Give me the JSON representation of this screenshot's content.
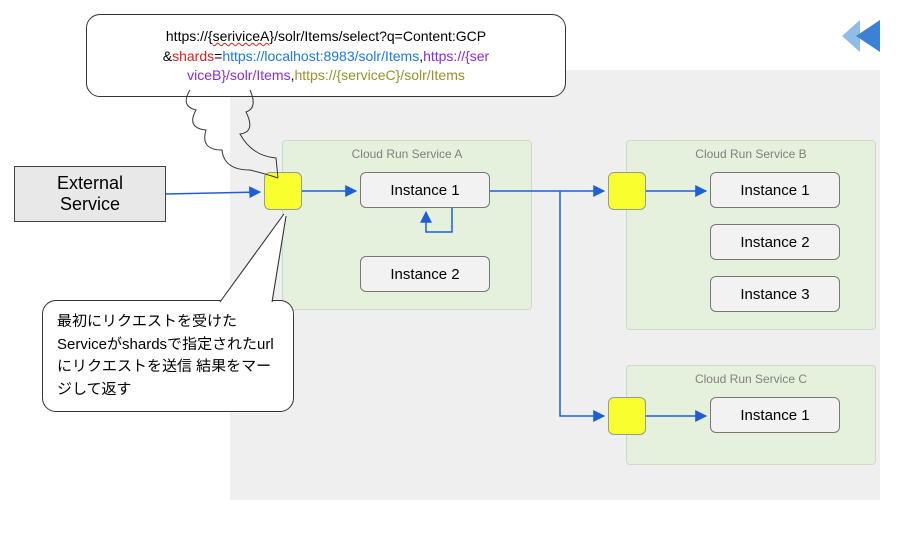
{
  "external": {
    "label": "External\nService"
  },
  "url": {
    "line1_a": "https://{",
    "line1_b": "seriviceA",
    "line1_c": "}/solr/Items/select?q=Content:GCP",
    "amp": "&",
    "shards": "shards",
    "eq": "=",
    "shard1": "https://localhost:8983/solr/Items",
    "comma1": ",",
    "shard2a": "https://{ser",
    "shard2b": "viceB}/solr/Items",
    "comma2": ",",
    "shard3": "https://{serviceC}/solr/Items"
  },
  "note": "最初にリクエストを受けたServiceがshardsで指定されたurlにリクエストを送信 結果をマージして返す",
  "services": {
    "A": {
      "title": "Cloud Run Service A",
      "inst1": "Instance 1",
      "inst2": "Instance 2"
    },
    "B": {
      "title": "Cloud Run Service B",
      "inst1": "Instance 1",
      "inst2": "Instance 2",
      "inst3": "Instance 3"
    },
    "C": {
      "title": "Cloud Run Service C",
      "inst1": "Instance 1"
    }
  }
}
